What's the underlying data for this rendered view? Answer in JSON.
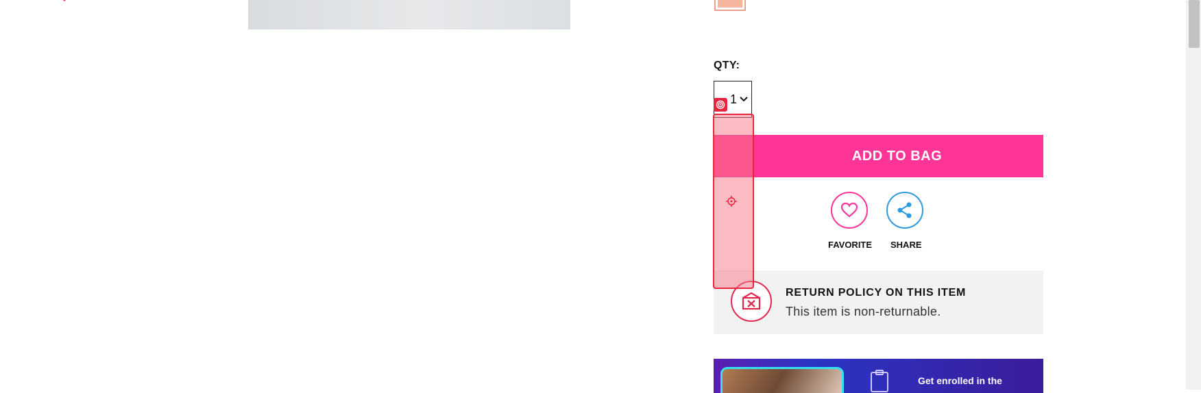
{
  "qty": {
    "label": "QTY:",
    "value": "1"
  },
  "add_to_bag": {
    "label": "ADD TO BAG"
  },
  "actions": {
    "favorite_label": "FAVORITE",
    "share_label": "SHARE"
  },
  "return_policy": {
    "title": "RETURN POLICY ON THIS ITEM",
    "text": "This item is non-returnable."
  },
  "promo": {
    "text": "Get enrolled in the"
  },
  "colors": {
    "accent_pink": "#ff3497",
    "share_blue": "#2a9ae0",
    "return_red": "#e0284e",
    "overlay_red": "#e8243f",
    "swatch": "#f6b59f"
  },
  "icons": {
    "heart": "heart-icon",
    "share": "share-icon",
    "chevron": "chevron-down-icon",
    "return_box": "return-box-icon",
    "crosshair": "crosshair-icon",
    "target": "target-icon"
  }
}
